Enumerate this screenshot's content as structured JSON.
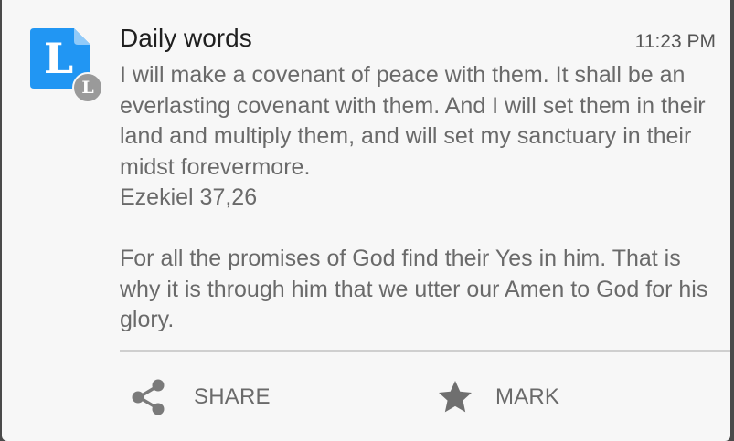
{
  "notification": {
    "app_icon_letter": "L",
    "app_badge_letter": "L",
    "title": "Daily words",
    "time": "11:23 PM",
    "verse_1": "I will make a covenant of peace with them. It shall be an everlasting covenant with them. And I will set them in their land and multiply them, and will set my sanctuary in their midst forevermore.",
    "reference_1": "Ezekiel 37,26",
    "verse_2": "For all the promises of God find their Yes in him. That is why it is through him that we utter our Amen to God for his glory."
  },
  "actions": {
    "share_label": "SHARE",
    "share_icon": "share-icon",
    "mark_label": "MARK",
    "mark_icon": "star-icon"
  },
  "colors": {
    "card_background": "#f7f7f7",
    "icon_blue": "#2196f3",
    "icon_fold": "#90caf9",
    "badge_gray": "#9a9a9a",
    "text_primary": "#202020",
    "text_secondary": "#6a6a6a"
  }
}
